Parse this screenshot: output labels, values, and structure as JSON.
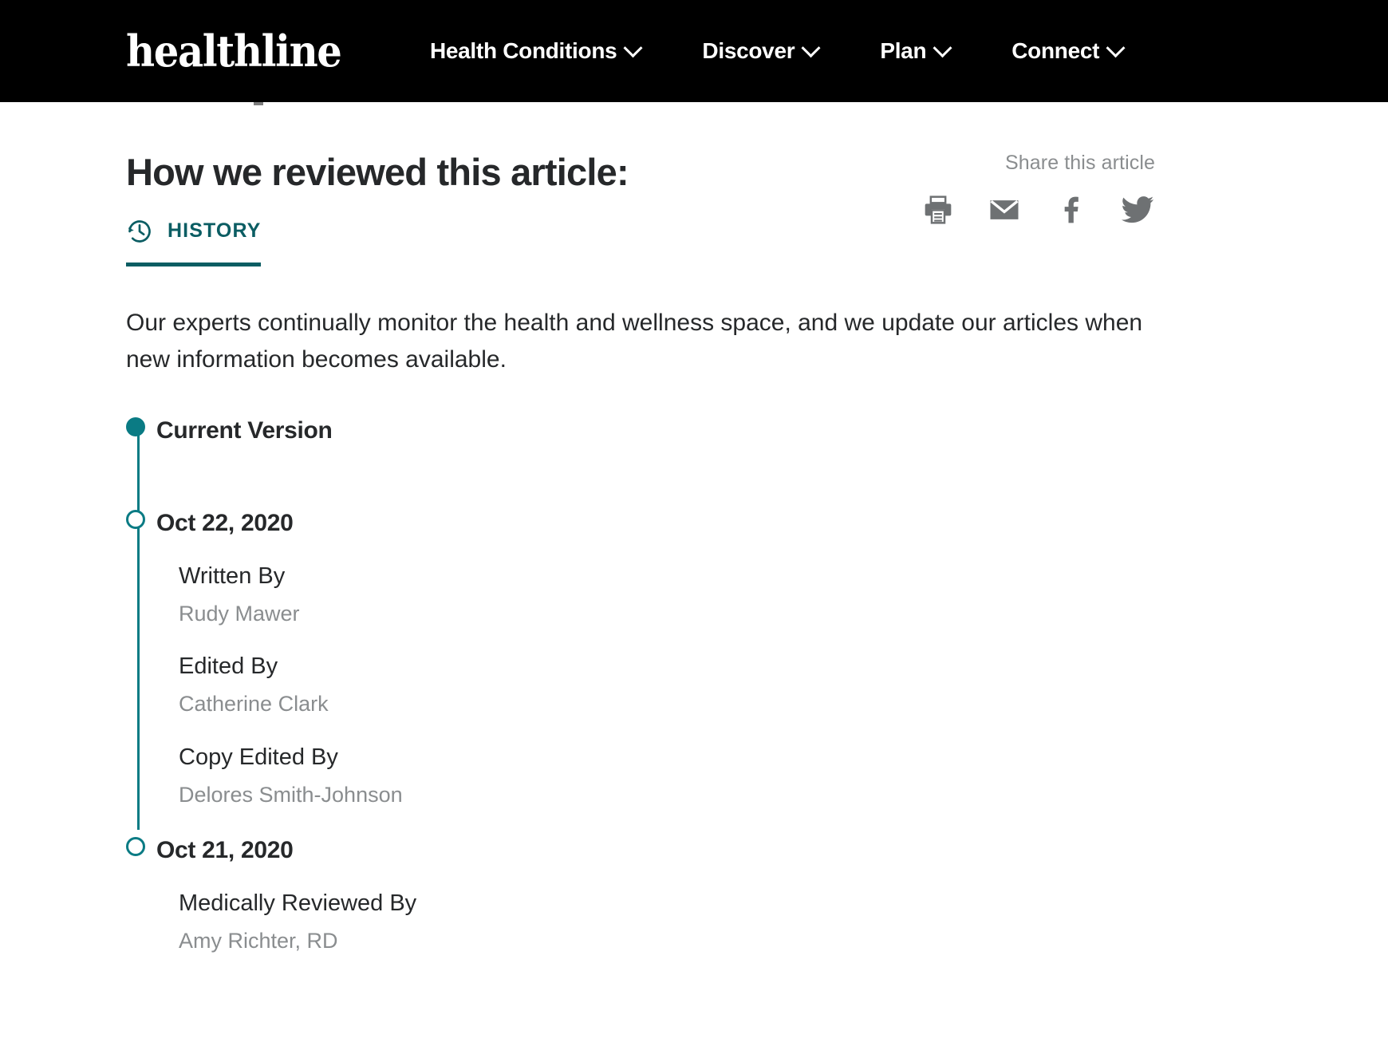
{
  "header": {
    "brand": "healthline",
    "nav": [
      {
        "label": "Health Conditions",
        "icon": "chevron-down-icon"
      },
      {
        "label": "Discover",
        "icon": "chevron-down-icon"
      },
      {
        "label": "Plan",
        "icon": "chevron-down-icon"
      },
      {
        "label": "Connect",
        "icon": "chevron-down-icon"
      }
    ],
    "background": "#000000",
    "text_color": "#ffffff"
  },
  "main": {
    "title": "How we reviewed this article:",
    "tab": {
      "label": "HISTORY",
      "icon": "history-clock-icon",
      "active": true
    },
    "paragraph": "Our experts continually monitor the health and wellness space, and we update our articles when new information becomes available."
  },
  "share": {
    "title": "Share this article",
    "icons": [
      {
        "name": "print-icon",
        "label": "Print"
      },
      {
        "name": "email-icon",
        "label": "Email"
      },
      {
        "name": "facebook-icon",
        "label": "Facebook"
      },
      {
        "name": "twitter-icon",
        "label": "Twitter"
      }
    ],
    "color": "#6e7173"
  },
  "timeline": {
    "current_version_label": "Current Version",
    "entries": [
      {
        "date": "Oct 22, 2020",
        "marker": "hollow",
        "credits": [
          {
            "label": "Written By",
            "value": "Rudy Mawer"
          },
          {
            "label": "Edited By",
            "value": "Catherine Clark"
          },
          {
            "label": "Copy Edited By",
            "value": "Delores Smith-Johnson"
          }
        ]
      },
      {
        "date": "Oct 21, 2020",
        "marker": "hollow",
        "credits": [
          {
            "label": "Medically Reviewed By",
            "value": "Amy Richter, RD"
          }
        ]
      }
    ]
  },
  "colors": {
    "teal_accent": "#0a7b84",
    "teal_dark": "#0b5d63",
    "text_dark": "#26282a",
    "text_muted": "#8a8d8f",
    "header_bg": "#000000"
  }
}
